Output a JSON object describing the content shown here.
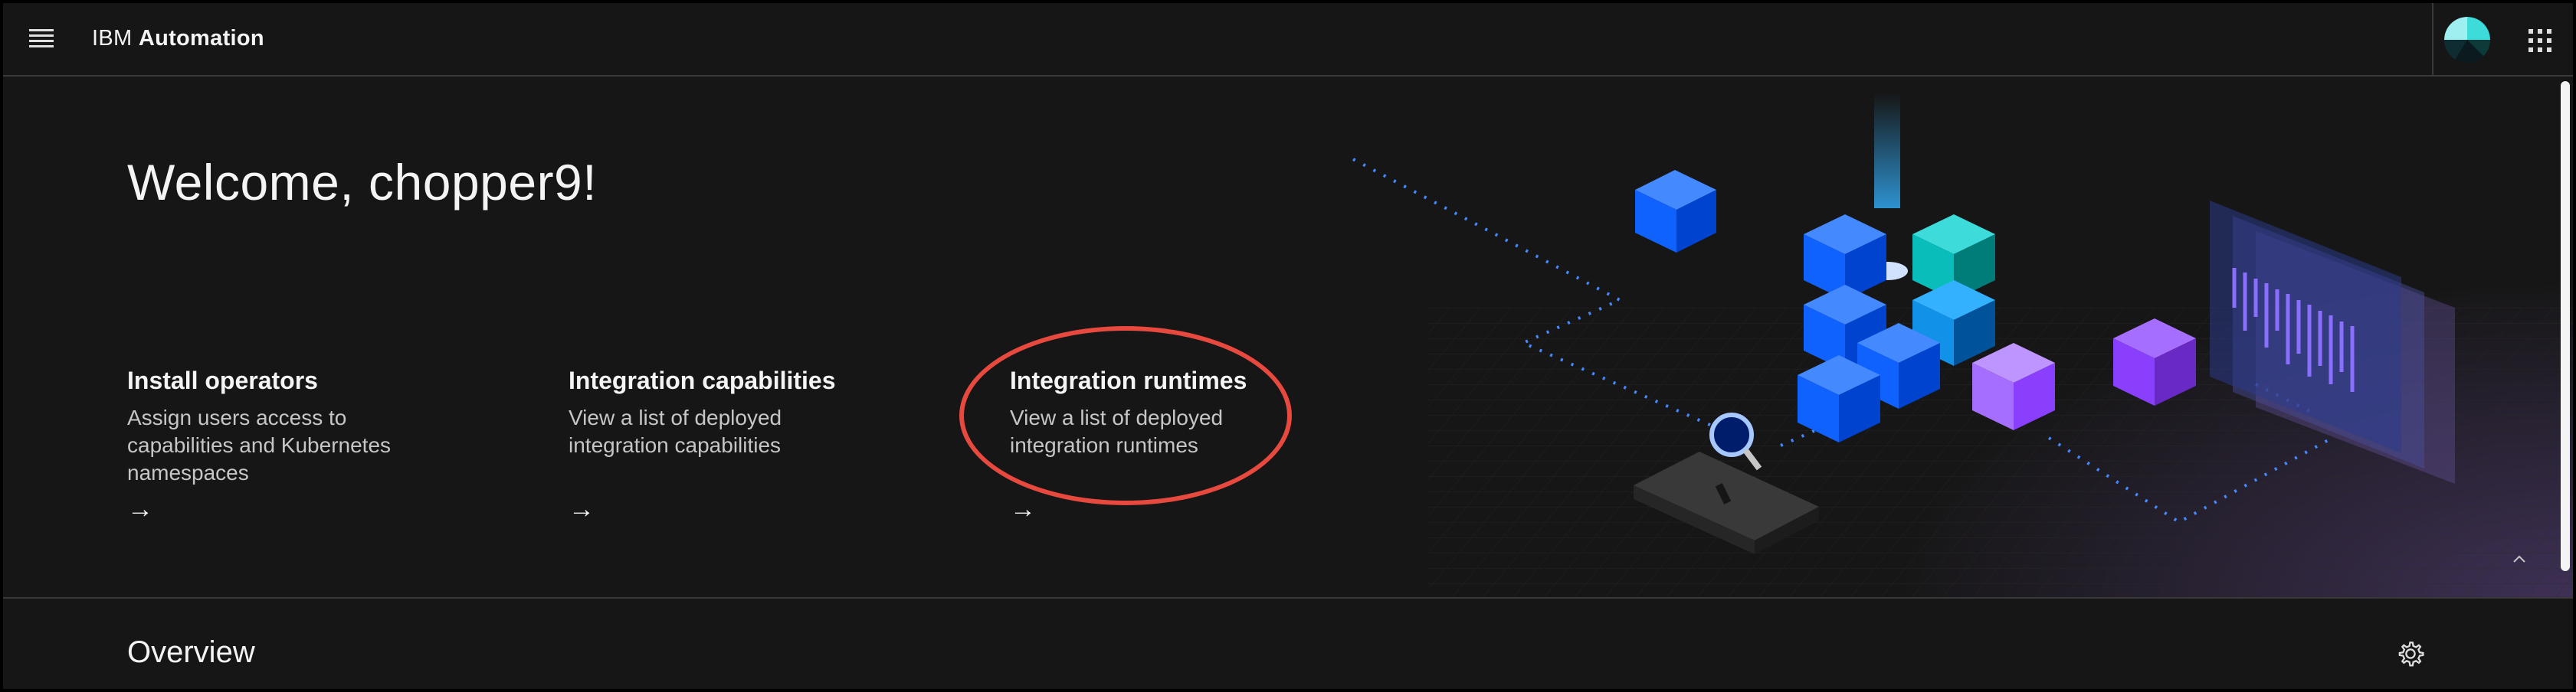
{
  "header": {
    "brand_prefix": "IBM",
    "brand_name": "Automation",
    "menu_icon": "hamburger-menu-icon",
    "apps_icon": "app-switcher-grid-icon"
  },
  "hero": {
    "welcome": "Welcome, chopper9!",
    "tiles": [
      {
        "title": "Install operators",
        "desc_lines": [
          "Assign users access to",
          "capabilities and Kubernetes",
          "namespaces"
        ],
        "arrow": "→"
      },
      {
        "title": "Integration capabilities",
        "desc_lines": [
          "View a list of deployed",
          "integration capabilities"
        ],
        "arrow": "→"
      },
      {
        "title": "Integration runtimes",
        "desc_lines": [
          "View a list of deployed",
          "integration runtimes"
        ],
        "arrow": "→"
      }
    ],
    "collapse_icon": "chevron-up-icon",
    "annotation_color": "#e8493f"
  },
  "overview": {
    "title": "Overview",
    "settings_icon": "gear-icon"
  },
  "colors": {
    "background": "#161616",
    "text_primary": "#f4f4f4",
    "text_secondary": "#c6c6c6",
    "accent_blue": "#0f62fe",
    "accent_purple": "#8a3ffc",
    "accent_teal": "#08bdba"
  }
}
